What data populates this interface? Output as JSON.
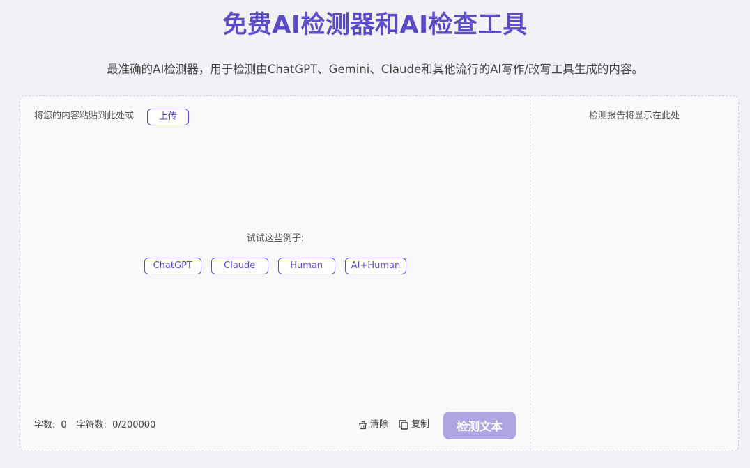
{
  "header": {
    "title": "免费AI检测器和AI检查工具",
    "subtitle": "最准确的AI检测器，用于检测由ChatGPT、Gemini、Claude和其他流行的AI写作/改写工具生成的内容。"
  },
  "editor": {
    "paste_hint": "将您的内容粘贴到此处或",
    "upload_label": "上传",
    "examples_label": "试试这些例子:",
    "examples": [
      "ChatGPT",
      "Claude",
      "Human",
      "AI+Human"
    ],
    "word_count_label": "字数:",
    "word_count_value": "0",
    "char_count_label": "字符数:",
    "char_count_value": "0/200000",
    "clear_label": "清除",
    "copy_label": "复制",
    "detect_label": "检测文本"
  },
  "report": {
    "placeholder": "检测报告将显示在此处"
  },
  "colors": {
    "accent": "#5b4bc4",
    "detect_button_disabled": "#ada6e0",
    "page_background": "#f1f1f6"
  },
  "icons": {
    "clear": "basket-icon",
    "copy": "copy-icon"
  }
}
